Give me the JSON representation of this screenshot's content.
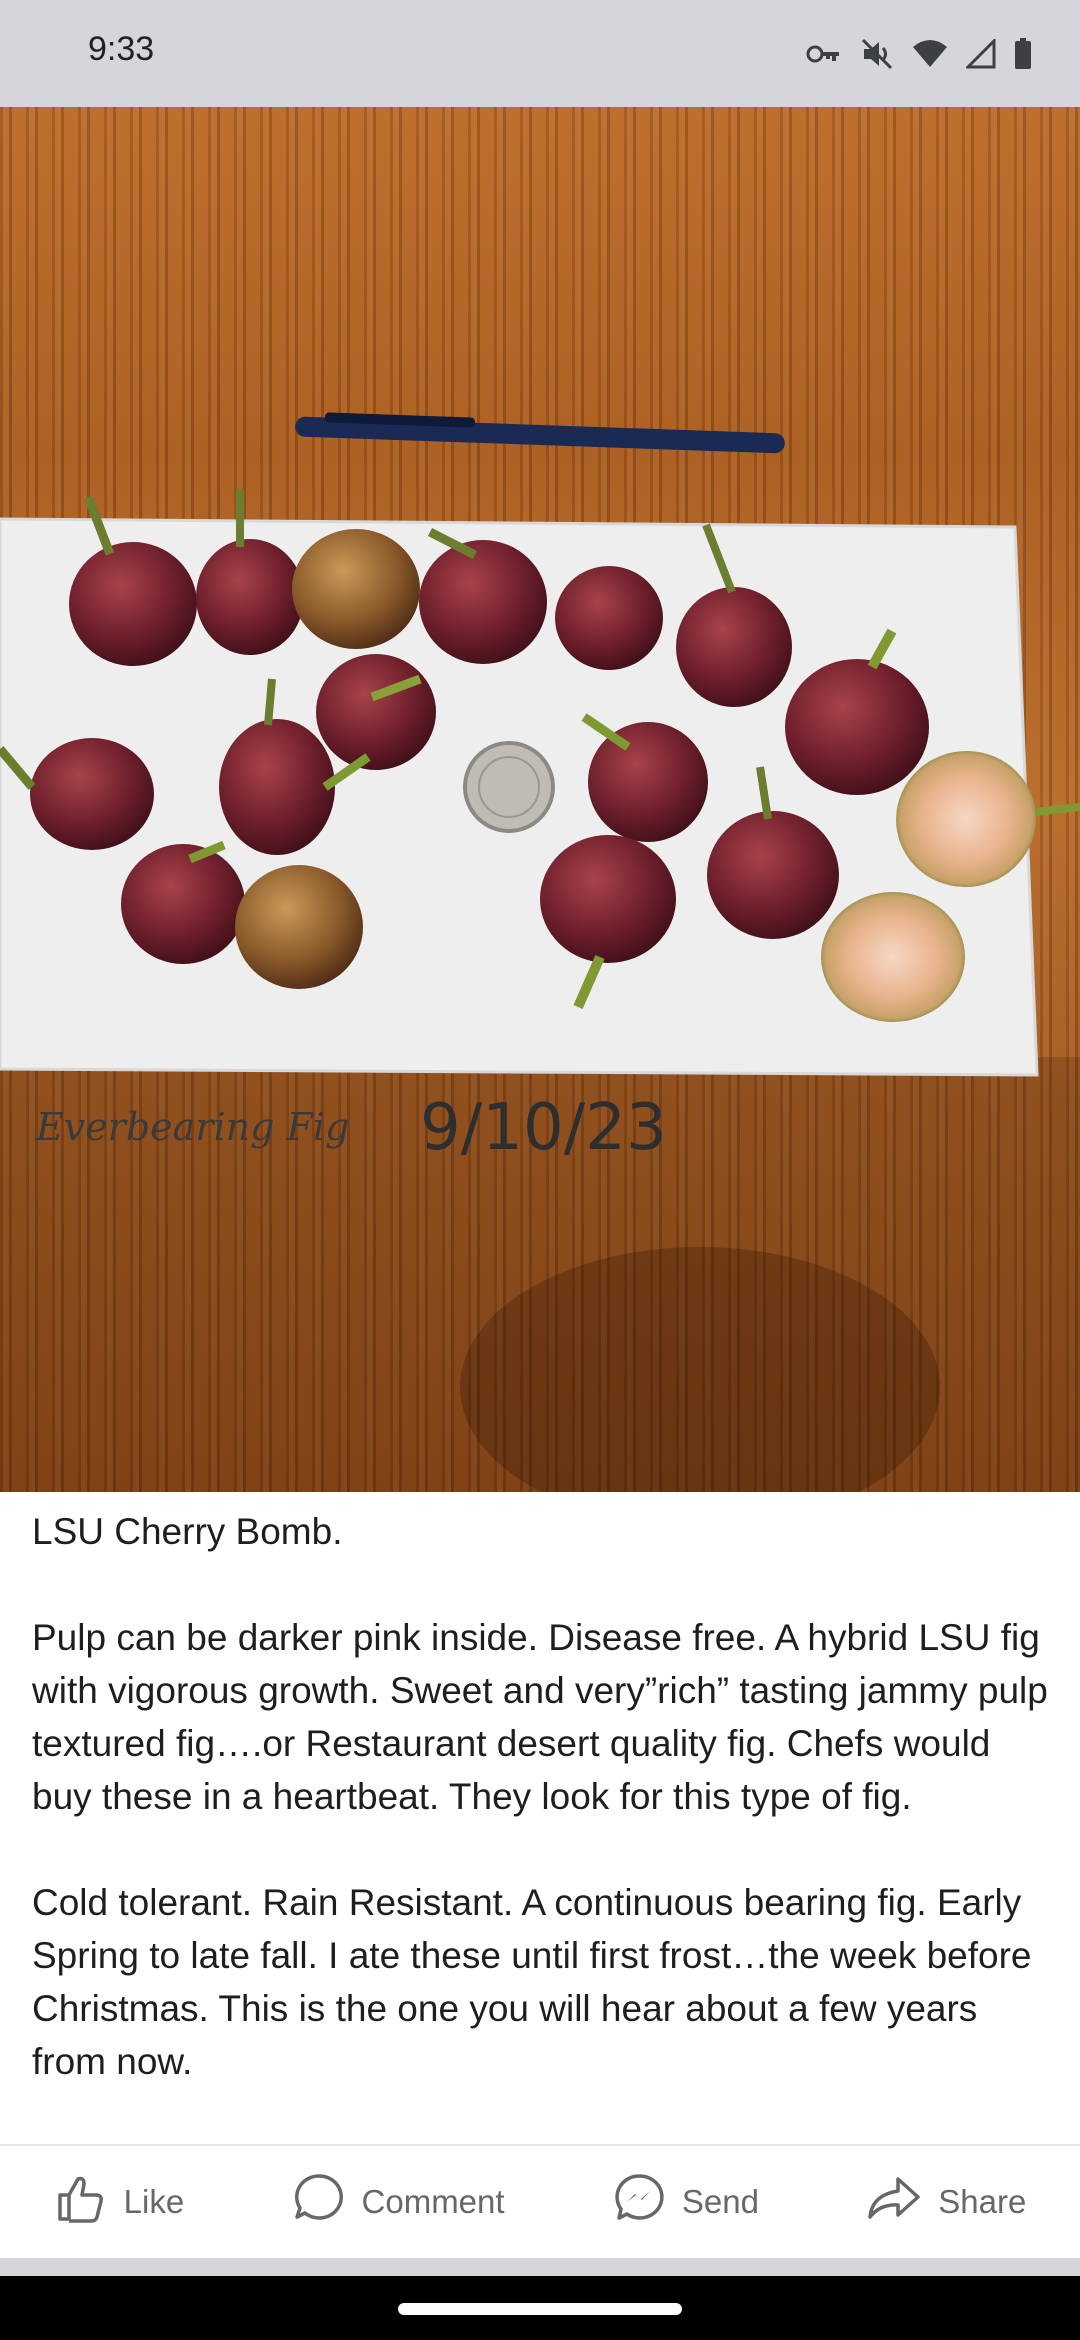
{
  "status_bar": {
    "time": "9:33",
    "icons": [
      "vpn-key-icon",
      "mute-icon",
      "wifi-icon",
      "signal-icon",
      "battery-icon"
    ]
  },
  "photo": {
    "handwriting_left": "Everbearing Fig",
    "handwriting_right": "9/10/23"
  },
  "post": {
    "paragraphs": [
      "LSU Cherry Bomb.",
      "Pulp can be darker pink  inside. Disease free. A hybrid LSU  fig with  vigorous growth. Sweet and very”rich” tasting jammy pulp textured fig….or Restaurant desert quality fig. Chefs would buy these in a heartbeat. They look for this type of fig.",
      "Cold tolerant. Rain Resistant. A continuous bearing fig. Early Spring to late fall. I ate these until first frost…the week before Christmas. This is the one you will hear about a few years from now."
    ]
  },
  "actions": {
    "like": "Like",
    "comment": "Comment",
    "send": "Send",
    "share": "Share"
  },
  "colors": {
    "action_text": "#65676b",
    "post_text": "#1c1e21",
    "status_bar_bg": "#d4d6db"
  }
}
